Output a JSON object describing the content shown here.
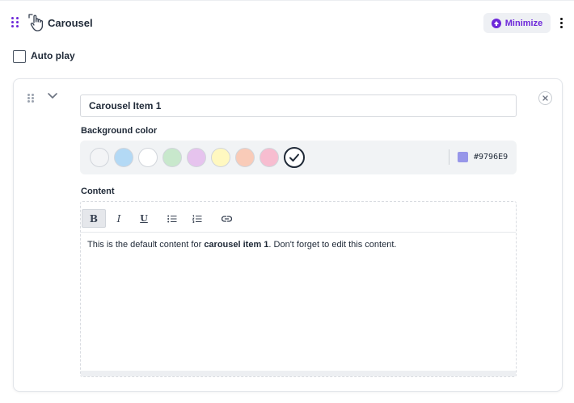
{
  "header": {
    "title": "Carousel",
    "minimize_label": "Minimize",
    "drag_icon": "drag-handle-icon",
    "type_icon": "hand-pointer-icon",
    "menu_icon": "kebab-menu-icon"
  },
  "autoplay": {
    "label": "Auto play",
    "checked": false
  },
  "item": {
    "title_value": "Carousel Item 1",
    "background_label": "Background color",
    "swatches": [
      "#f3f4f6",
      "#b3d9f5",
      "#ffffff",
      "#c8e8cc",
      "#e6c3ee",
      "#fff8c0",
      "#f9cbb8",
      "#f7bdd0"
    ],
    "selected_color_hex": "#9796E9",
    "content_label": "Content",
    "content_text_before": "This is the default content for ",
    "content_text_bold": "carousel item 1",
    "content_text_after": ". Don't forget to edit this content.",
    "toolbar": {
      "bold": "B",
      "italic": "I",
      "underline": "U"
    }
  },
  "colors": {
    "accent": "#6d28d9",
    "button_bg": "#eef0f4"
  }
}
